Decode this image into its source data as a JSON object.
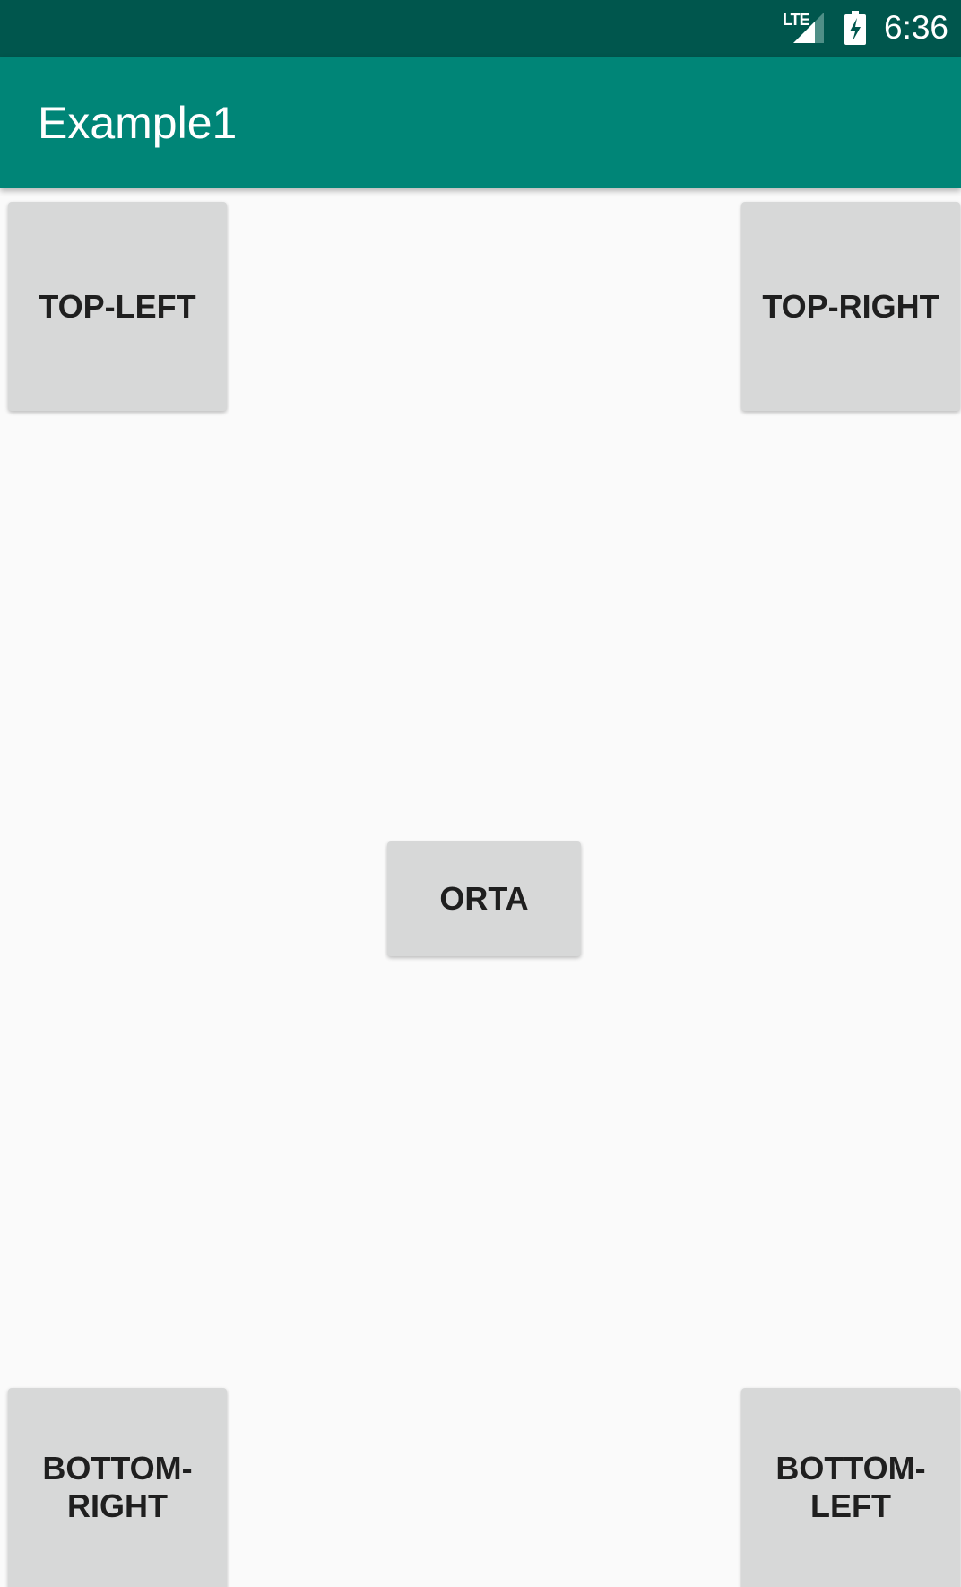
{
  "status_bar": {
    "network_label": "LTE",
    "time": "6:36",
    "icons": [
      "signal-icon",
      "battery-charging-icon"
    ],
    "background_color": "#00564d"
  },
  "app_bar": {
    "title": "Example1",
    "background_color": "#008577"
  },
  "buttons": {
    "top_left": "TOP-LEFT",
    "top_right": "TOP-RIGHT",
    "center": "ORTA",
    "bottom_right": "BOTTOM-\nRIGHT",
    "bottom_left": "BOTTOM-\nLEFT"
  },
  "colors": {
    "button_background": "#d7d8d8",
    "page_background": "#fafafa"
  }
}
